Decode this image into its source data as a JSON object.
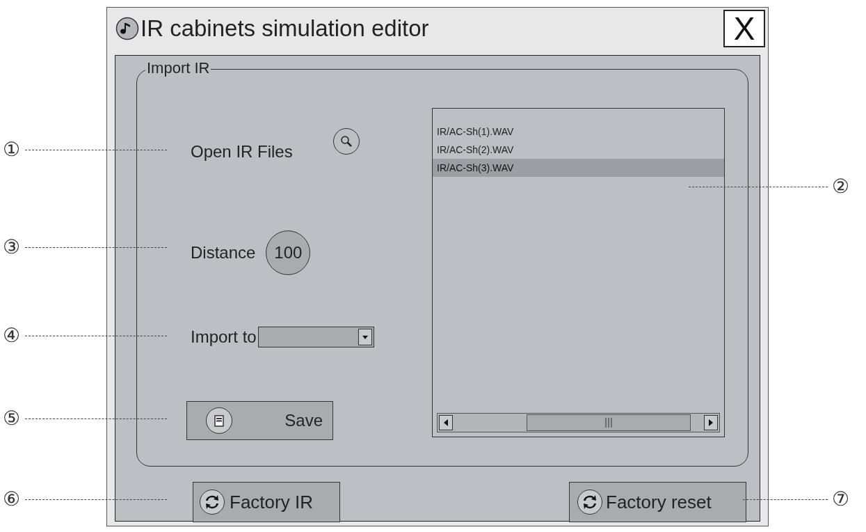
{
  "window": {
    "title": "IR cabinets simulation editor",
    "close_label": "X"
  },
  "group": {
    "legend": "Import IR",
    "open_files": {
      "label": "Open IR Files"
    },
    "distance": {
      "label": "Distance",
      "value": "100"
    },
    "import_to": {
      "label": "Import to"
    },
    "save_button": {
      "label": "Save"
    },
    "file_list": [
      {
        "name": "IR/AC-Sh(1).WAV",
        "selected": false
      },
      {
        "name": "IR/AC-Sh(2).WAV",
        "selected": false
      },
      {
        "name": "IR/AC-Sh(3).WAV",
        "selected": true
      }
    ]
  },
  "buttons": [
    {
      "label": "Factory IR"
    },
    {
      "label": "Factory reset"
    }
  ],
  "left_callouts": [
    "①",
    "③",
    "④",
    "⑤",
    "⑥"
  ],
  "right_callouts": [
    "②",
    "⑦"
  ]
}
